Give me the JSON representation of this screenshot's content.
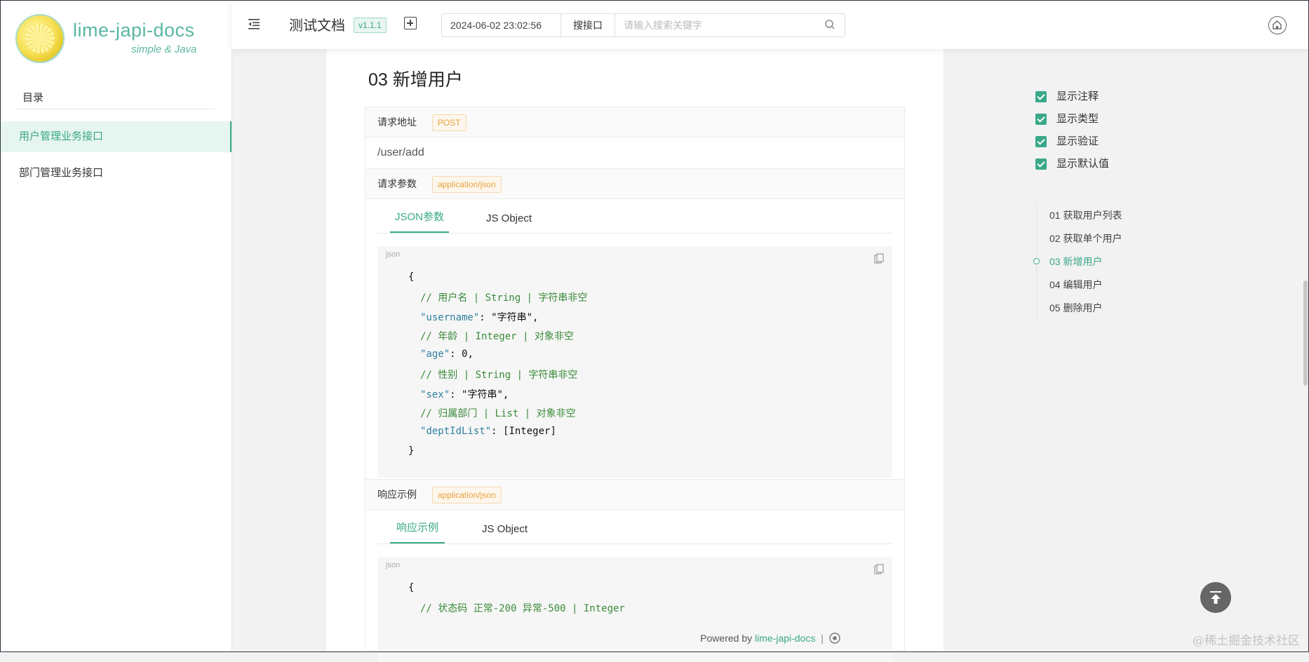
{
  "sidebar": {
    "logo_title": "lime-japi-docs",
    "logo_subtitle": "simple & Java",
    "toc_heading": "目录",
    "items": [
      {
        "label": "用户管理业务接口",
        "active": true
      },
      {
        "label": "部门管理业务接口",
        "active": false
      }
    ]
  },
  "header": {
    "doc_title": "测试文档",
    "version": "v1.1.1",
    "datetime": "2024-06-02 23:02:56",
    "search_select": "搜接口",
    "search_placeholder": "请输入搜索关键字"
  },
  "main": {
    "section_title": "03  新增用户",
    "request": {
      "label": "请求地址",
      "method": "POST",
      "url": "/user/add"
    },
    "params": {
      "label": "请求参数",
      "content_type": "application/json",
      "tabs": [
        "JSON参数",
        "JS Object"
      ],
      "code_lang": "json",
      "code": {
        "open": "{",
        "c1": "// 用户名 | String | 字符串非空",
        "k1": "\"username\"",
        "v1": ": \"字符串\",",
        "c2": "// 年龄 | Integer | 对象非空",
        "k2": "\"age\"",
        "v2": ": 0,",
        "c3": "// 性别 | String | 字符串非空",
        "k3": "\"sex\"",
        "v3": ": \"字符串\",",
        "c4": "// 归属部门 | List | 对象非空",
        "k4": "\"deptIdList\"",
        "v4": ": [Integer]",
        "close": "}"
      }
    },
    "response": {
      "label": "响应示例",
      "content_type": "application/json",
      "tabs": [
        "响应示例",
        "JS Object"
      ],
      "code_lang": "json",
      "code": {
        "open": "{",
        "c1": "// 状态码 正常-200 异常-500 | Integer"
      }
    }
  },
  "options": [
    "显示注释",
    "显示类型",
    "显示验证",
    "显示默认值"
  ],
  "anchors": [
    {
      "label": "01 获取用户列表",
      "active": false
    },
    {
      "label": "02 获取单个用户",
      "active": false
    },
    {
      "label": "03 新增用户",
      "active": true
    },
    {
      "label": "04 编辑用户",
      "active": false
    },
    {
      "label": "05 删除用户",
      "active": false
    }
  ],
  "footer": {
    "powered": "Powered by",
    "link": "lime-japi-docs",
    "sep": "|"
  },
  "watermark": "@稀土掘金技术社区",
  "colors": {
    "accent": "#3aa889",
    "tag_orange": "#e6a23c"
  },
  "icons": [
    "menu-icon",
    "plus-icon",
    "search-icon",
    "home-icon",
    "copy-icon",
    "back-to-top-icon",
    "github-icon"
  ]
}
